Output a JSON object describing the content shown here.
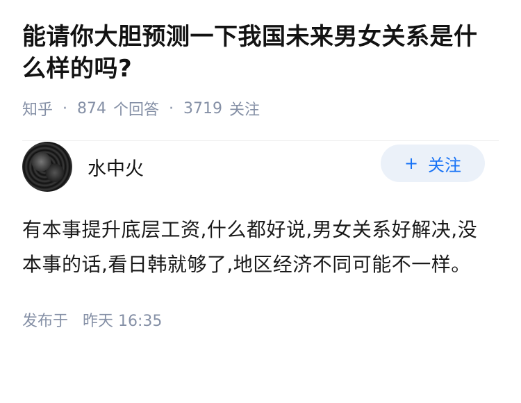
{
  "question": {
    "title": "能请你大胆预测一下我国未来男女关系是什么样的吗?",
    "source": "知乎",
    "separator": "·",
    "answers_count": "874",
    "answers_label": "个回答",
    "followers_count": "3719",
    "followers_label": "关注"
  },
  "answer": {
    "author": {
      "name": "水中火",
      "avatar_icon": "avatar-photo"
    },
    "follow_button": {
      "icon": "plus-icon",
      "plus": "+",
      "label": "关注"
    },
    "content": "有本事提升底层工资,什么都好说,男女关系好解决,没本事的话,看日韩就够了,地区经济不同可能不一样。",
    "published_label": "发布于",
    "published_time": "昨天 16:35"
  },
  "colors": {
    "meta_gray": "#8590a6",
    "accent_blue": "#1772f6",
    "follow_bg": "#ebf1f9",
    "title_text": "#121212"
  }
}
